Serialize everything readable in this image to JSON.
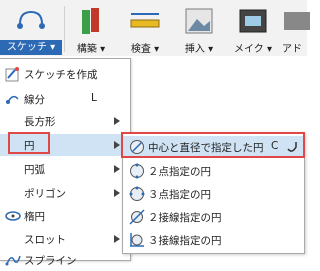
{
  "toolbar": {
    "groups": [
      {
        "label": "スケッチ ▾",
        "icon": "sketch-icon"
      },
      {
        "label": "構築 ▾",
        "icon": "construct-icon"
      },
      {
        "label": "検査 ▾",
        "icon": "inspect-icon"
      },
      {
        "label": "挿入 ▾",
        "icon": "insert-icon"
      },
      {
        "label": "メイク ▾",
        "icon": "make-icon"
      },
      {
        "label": "アド",
        "icon": "addins-icon"
      }
    ]
  },
  "menu": {
    "items": [
      {
        "label": "スケッチを作成",
        "icon": "create-sketch-icon"
      },
      {
        "label": "線分",
        "shortcut": "L",
        "icon": "line-icon"
      },
      {
        "label": "長方形",
        "icon": ""
      },
      {
        "label": "円",
        "icon": ""
      },
      {
        "label": "円弧",
        "icon": ""
      },
      {
        "label": "ポリゴン",
        "icon": ""
      },
      {
        "label": "楕円",
        "icon": "ellipse-icon"
      },
      {
        "label": "スロット",
        "icon": ""
      },
      {
        "label": "スプライン",
        "icon": "spline-icon"
      }
    ]
  },
  "submenu": {
    "items": [
      {
        "label": "中心と直径で指定した円",
        "shortcut": "C",
        "icon": "center-diameter-circle-icon"
      },
      {
        "label": "２点指定の円",
        "icon": "two-point-circle-icon"
      },
      {
        "label": "３点指定の円",
        "icon": "three-point-circle-icon"
      },
      {
        "label": "２接線指定の円",
        "icon": "two-tangent-circle-icon"
      },
      {
        "label": "３接線指定の円",
        "icon": "three-tangent-circle-icon"
      }
    ]
  },
  "colors": {
    "accent": "#2d6ab5",
    "highlight": "#cfe3f5",
    "callout": "#e04848"
  }
}
